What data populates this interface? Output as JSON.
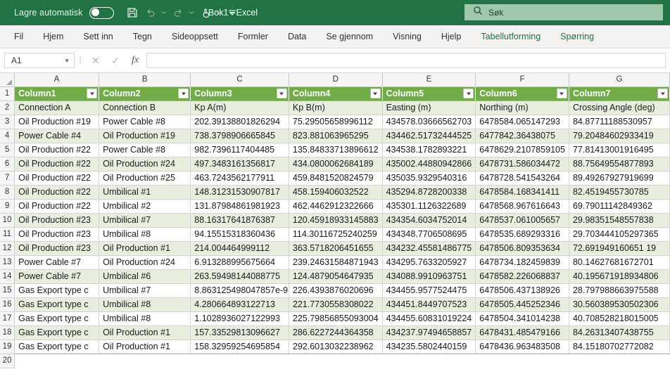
{
  "titlebar": {
    "autosave_label": "Lagre automatisk",
    "autosave_state": "off",
    "document_title": "Bok1  -  Excel",
    "search_placeholder": "Søk",
    "qat": [
      {
        "name": "save-icon",
        "label": "Lagre"
      },
      {
        "name": "undo-icon",
        "label": "Angre"
      },
      {
        "name": "redo-icon",
        "label": "Gjør om"
      },
      {
        "name": "touch-mode-icon",
        "label": "Berørings-/musemodus"
      },
      {
        "name": "customize-quick-access-icon",
        "label": "Tilpass verktøylinje for hurtigtilgang"
      }
    ]
  },
  "ribbon": {
    "tabs": [
      {
        "label": "Fil",
        "contextual": false
      },
      {
        "label": "Hjem",
        "contextual": false
      },
      {
        "label": "Sett inn",
        "contextual": false
      },
      {
        "label": "Tegn",
        "contextual": false
      },
      {
        "label": "Sideoppsett",
        "contextual": false
      },
      {
        "label": "Formler",
        "contextual": false
      },
      {
        "label": "Data",
        "contextual": false
      },
      {
        "label": "Se gjennom",
        "contextual": false
      },
      {
        "label": "Visning",
        "contextual": false
      },
      {
        "label": "Hjelp",
        "contextual": false
      },
      {
        "label": "Tabellutforming",
        "contextual": true
      },
      {
        "label": "Spørring",
        "contextual": true
      }
    ]
  },
  "formula_bar": {
    "name_box_value": "A1",
    "cancel_label": "✕",
    "confirm_label": "✓",
    "fx_label": "fx",
    "formula_value": ""
  },
  "grid": {
    "column_letters": [
      "A",
      "B",
      "C",
      "D",
      "E",
      "F",
      "G"
    ],
    "row_numbers": [
      "1",
      "2",
      "3",
      "4",
      "5",
      "6",
      "7",
      "8",
      "9",
      "10",
      "11",
      "12",
      "13",
      "14",
      "15",
      "16",
      "17",
      "18",
      "19",
      "20"
    ],
    "table_headers": [
      "Column1",
      "Column2",
      "Column3",
      "Column4",
      "Column5",
      "Column6",
      "Column7"
    ],
    "rows": [
      [
        "Connection A",
        "Connection B",
        "Kp A(m)",
        "Kp B(m)",
        "Easting (m)",
        "Northing (m)",
        "Crossing Angle (deg)"
      ],
      [
        "Oil Production  #19",
        "Power Cable #8",
        "202.39138801826294",
        "75.29505658996112",
        "434578.03666562703",
        "6478584.065147293",
        "84.87711188530957"
      ],
      [
        "Power Cable #4",
        "Oil Production #19",
        "738.3798906665845",
        "823.881063965295",
        "434462.51732444525",
        "6477842.36438075",
        "79.20484602933419"
      ],
      [
        "Oil Production  #22",
        "Power Cable #8",
        "982.7396117404485",
        "135.84833713896612",
        "434538.1782893221",
        "6478629.2107859105",
        "77.81413001916495"
      ],
      [
        "Oil Production  #22",
        "Oil Production #24",
        "497.3483161356817",
        "434.0800062684189",
        "435002.44880942866",
        "6478731.586034472",
        "88.75649554877893"
      ],
      [
        "Oil Production  #22",
        "Oil Production #25",
        "463.7243562177911",
        "459.8481520824579",
        "435035.9329540316",
        "6478728.541543264",
        "89.49267927919699"
      ],
      [
        "Oil Production  #22",
        "Umbilical #1",
        "148.31231530907817",
        "458.159406032522",
        "435294.8728200338",
        "6478584.168341411",
        "82.4519455730785"
      ],
      [
        "Oil Production  #22",
        "Umbilical #2",
        "131.87984861981923",
        "462.4462912322666",
        "435301.1126322689",
        "6478568.967616643",
        "69.79011142849362"
      ],
      [
        "Oil Production  #23",
        "Umbilical #7",
        "88.16317641876387",
        "120.45918933145883",
        "434354.6034752014",
        "6478537.061005657",
        "29.98351548557838"
      ],
      [
        "Oil Production  #23",
        "Umbilical #8",
        "94.15515318360436",
        "114.30116725240259",
        "434348.7706508695",
        "6478535.689293316",
        "29.703444105297365"
      ],
      [
        "Oil Production  #23",
        "Oil Production #1",
        "214.004464999112",
        "363.5718206451655",
        "434232.45581486775",
        "6478506.809353634",
        "72.691949160651 19"
      ],
      [
        "Power Cable #7",
        "Oil Production  #24",
        "6.913288995675664",
        "239.24631584871943",
        "434295.7633205927",
        "6478734.182459839",
        "80.14627681672701"
      ],
      [
        "Power Cable #7",
        "Umbilical #6",
        "263.59498144088775",
        "124.4879054647935",
        "434088.9910963751",
        "6478582.226068837",
        "40.195671918934806"
      ],
      [
        "Gas Export type c",
        "Umbilical #7",
        "8.863125498047857e-9",
        "226.4393876020696",
        "434455.9577524475",
        "6478506.437138926",
        "28.797988663975588"
      ],
      [
        "Gas Export type c",
        "Umbilical #8",
        "4.280664893122713",
        "221.7730558308022",
        "434451.8449707523",
        "6478505.445252346",
        "30.560389530502306"
      ],
      [
        "Gas Export type c",
        "Umbilical #8",
        "1.1028936027122993",
        "225.79856855093004",
        "434455.60831019224",
        "6478504.341014238",
        "40.708528218015005"
      ],
      [
        "Gas Export type c",
        "Oil Production #1",
        "157.33529813096627",
        "286.6227244364358",
        "434237.97494658857",
        "6478431.485479166",
        "84.26313407438755"
      ],
      [
        "Gas Export type c",
        "Oil Production #1",
        "158.32959254695854",
        "292.6013032238962",
        "434235.5802440159",
        "6478436.963483508",
        "84.15180702772082"
      ]
    ]
  },
  "colors": {
    "excel_green": "#217346",
    "table_header_green": "#70ad47",
    "band_green": "#e9efdf",
    "ribbon_bg": "#f3f2f1"
  }
}
